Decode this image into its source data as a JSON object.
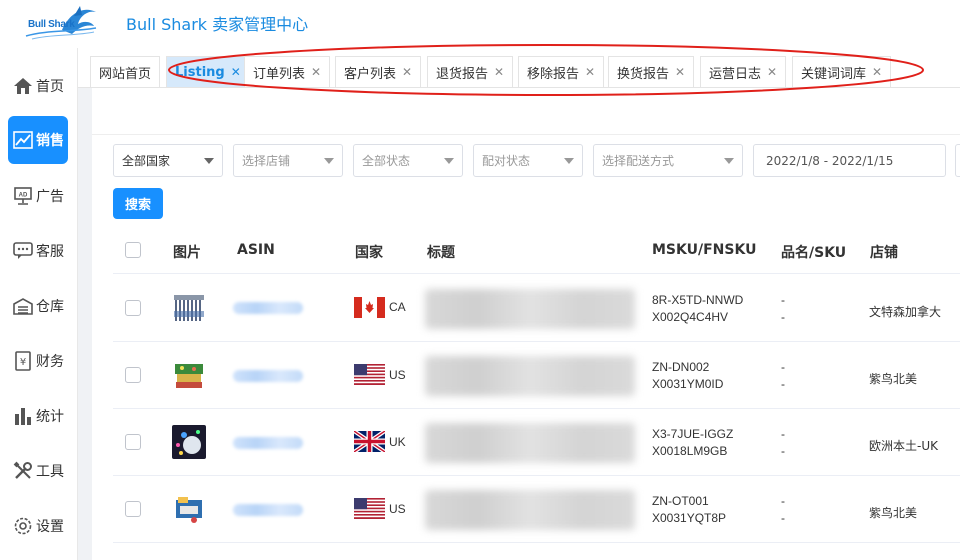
{
  "header": {
    "logo_text": "Bull Shark",
    "title": "Bull Shark 卖家管理中心"
  },
  "sidebar": {
    "items": [
      {
        "label": "首页",
        "icon": "home-icon"
      },
      {
        "label": "销售",
        "icon": "chart-trend-icon",
        "active": true
      },
      {
        "label": "广告",
        "icon": "ad-screen-icon"
      },
      {
        "label": "客服",
        "icon": "chat-bubble-icon"
      },
      {
        "label": "仓库",
        "icon": "warehouse-icon"
      },
      {
        "label": "财务",
        "icon": "yen-document-icon"
      },
      {
        "label": "统计",
        "icon": "bar-chart-icon"
      },
      {
        "label": "工具",
        "icon": "tools-icon"
      },
      {
        "label": "设置",
        "icon": "gear-icon"
      }
    ]
  },
  "tabs": [
    {
      "label": "网站首页",
      "closable": false
    },
    {
      "label": "Listing",
      "closable": true,
      "active": true
    },
    {
      "label": "订单列表",
      "closable": true
    },
    {
      "label": "客户列表",
      "closable": true
    },
    {
      "label": "退货报告",
      "closable": true
    },
    {
      "label": "移除报告",
      "closable": true
    },
    {
      "label": "换货报告",
      "closable": true
    },
    {
      "label": "运营日志",
      "closable": true
    },
    {
      "label": "关键词词库",
      "closable": true
    }
  ],
  "filters": {
    "country": "全部国家",
    "shop_placeholder": "选择店铺",
    "status_placeholder": "全部状态",
    "pairing_placeholder": "配对状态",
    "shipping_placeholder": "选择配送方式",
    "date_range": "2022/1/8 - 2022/1/15"
  },
  "search_label": "搜索",
  "table": {
    "columns": [
      "图片",
      "ASIN",
      "国家",
      "标题",
      "MSKU/FNSKU",
      "品名/SKU",
      "店铺"
    ],
    "rows": [
      {
        "country": "CA",
        "msku": "8R-X5TD-NNWD",
        "fnsku": "X002Q4C4HV",
        "name": "-",
        "sku": "-",
        "shop": "文特森加拿大"
      },
      {
        "country": "US",
        "msku": "ZN-DN002",
        "fnsku": "X0031YM0ID",
        "name": "-",
        "sku": "-",
        "shop": "紫鸟北美"
      },
      {
        "country": "UK",
        "msku": "X3-7JUE-IGGZ",
        "fnsku": "X0018LM9GB",
        "name": "-",
        "sku": "-",
        "shop": "欧洲本土-UK"
      },
      {
        "country": "US",
        "msku": "ZN-OT001",
        "fnsku": "X0031YQT8P",
        "name": "-",
        "sku": "-",
        "shop": "紫鸟北美"
      }
    ]
  },
  "colors": {
    "accent": "#1890ff",
    "title": "#1a8be0",
    "annotation": "#e0201a"
  }
}
